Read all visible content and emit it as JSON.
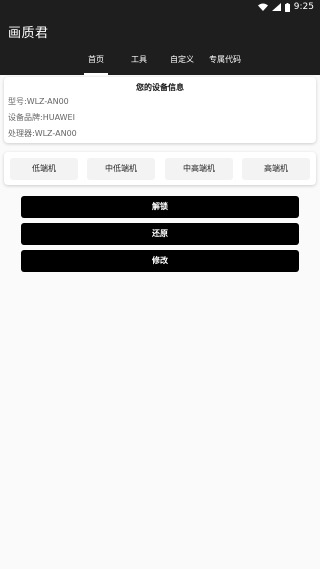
{
  "status_bar": {
    "time": "9:25"
  },
  "app": {
    "title": "画质君"
  },
  "tabs": [
    {
      "label": "首页",
      "active": true
    },
    {
      "label": "工具",
      "active": false
    },
    {
      "label": "自定义",
      "active": false
    },
    {
      "label": "专属代码",
      "active": false
    }
  ],
  "device_info": {
    "title": "您的设备信息",
    "model": "型号:WLZ-AN00",
    "brand": "设备品牌:HUAWEI",
    "processor": "处理器:WLZ-AN00"
  },
  "tiers": [
    "低端机",
    "中低端机",
    "中高端机",
    "高端机"
  ],
  "actions": {
    "unlock": "解锁",
    "restore": "还原",
    "modify": "修改"
  },
  "colors": {
    "bar_bg": "#1e1e1e",
    "button_bg": "#000000",
    "tier_bg": "#f3f3f3"
  }
}
